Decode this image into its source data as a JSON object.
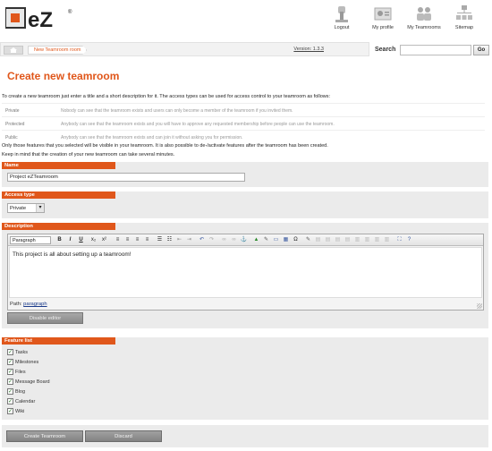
{
  "header": {
    "logo_text": "eZ",
    "links": [
      {
        "label": "Logout",
        "icon": "logout-icon"
      },
      {
        "label": "My profile",
        "icon": "profile-icon"
      },
      {
        "label": "My Teamrooms",
        "icon": "teamrooms-icon"
      },
      {
        "label": "Sitemap",
        "icon": "sitemap-icon"
      }
    ]
  },
  "pathbar": {
    "crumb": "New Teamroom room",
    "version": "Version: 1.3.3"
  },
  "search": {
    "label": "Search",
    "value": "",
    "go_label": "Go"
  },
  "page": {
    "title": "Create new teamroom",
    "intro": "To create a new teamroom just enter a title and a short description for it. The access types can be used for access control to your teamroom as follows:",
    "access_types": [
      {
        "name": "Private",
        "desc": "Nobody can see that the teamroom exists and users can only become a member of the teamroom if you invited them."
      },
      {
        "name": "Protected",
        "desc": "Anybody can see that the teamroom exists and you will have to approve any requested membership before people can use the teamroom."
      },
      {
        "name": "Public",
        "desc": "Anybody can see that the teamroom exists and can join it without asking you for permission."
      }
    ],
    "note1": "Only those features that you selected will be visible in your teamroom. It is also possible to de-/activate features after the teamroom has been created.",
    "note2": "Keep in mind that the creation of your new teamroom can take several minutes."
  },
  "form": {
    "name_label": "Name",
    "name_value": "Project eZTeamroom",
    "access_label": "Access type",
    "access_value": "Private",
    "description_label": "Description",
    "format_value": "Paragraph",
    "description_text": "This project is all about setting up a teamroom!",
    "path_label": "Path:",
    "path_value": "paragraph",
    "disable_editor_label": "Disable editor",
    "feature_label": "Feature list",
    "features": [
      {
        "label": "Tasks",
        "checked": true
      },
      {
        "label": "Milestones",
        "checked": true
      },
      {
        "label": "Files",
        "checked": true
      },
      {
        "label": "Message Board",
        "checked": true
      },
      {
        "label": "Blog",
        "checked": true
      },
      {
        "label": "Calendar",
        "checked": true
      },
      {
        "label": "Wiki",
        "checked": true
      }
    ],
    "create_label": "Create Teamroom",
    "discard_label": "Discard"
  },
  "colors": {
    "accent": "#e0571b",
    "block_bg": "#ebebeb"
  }
}
